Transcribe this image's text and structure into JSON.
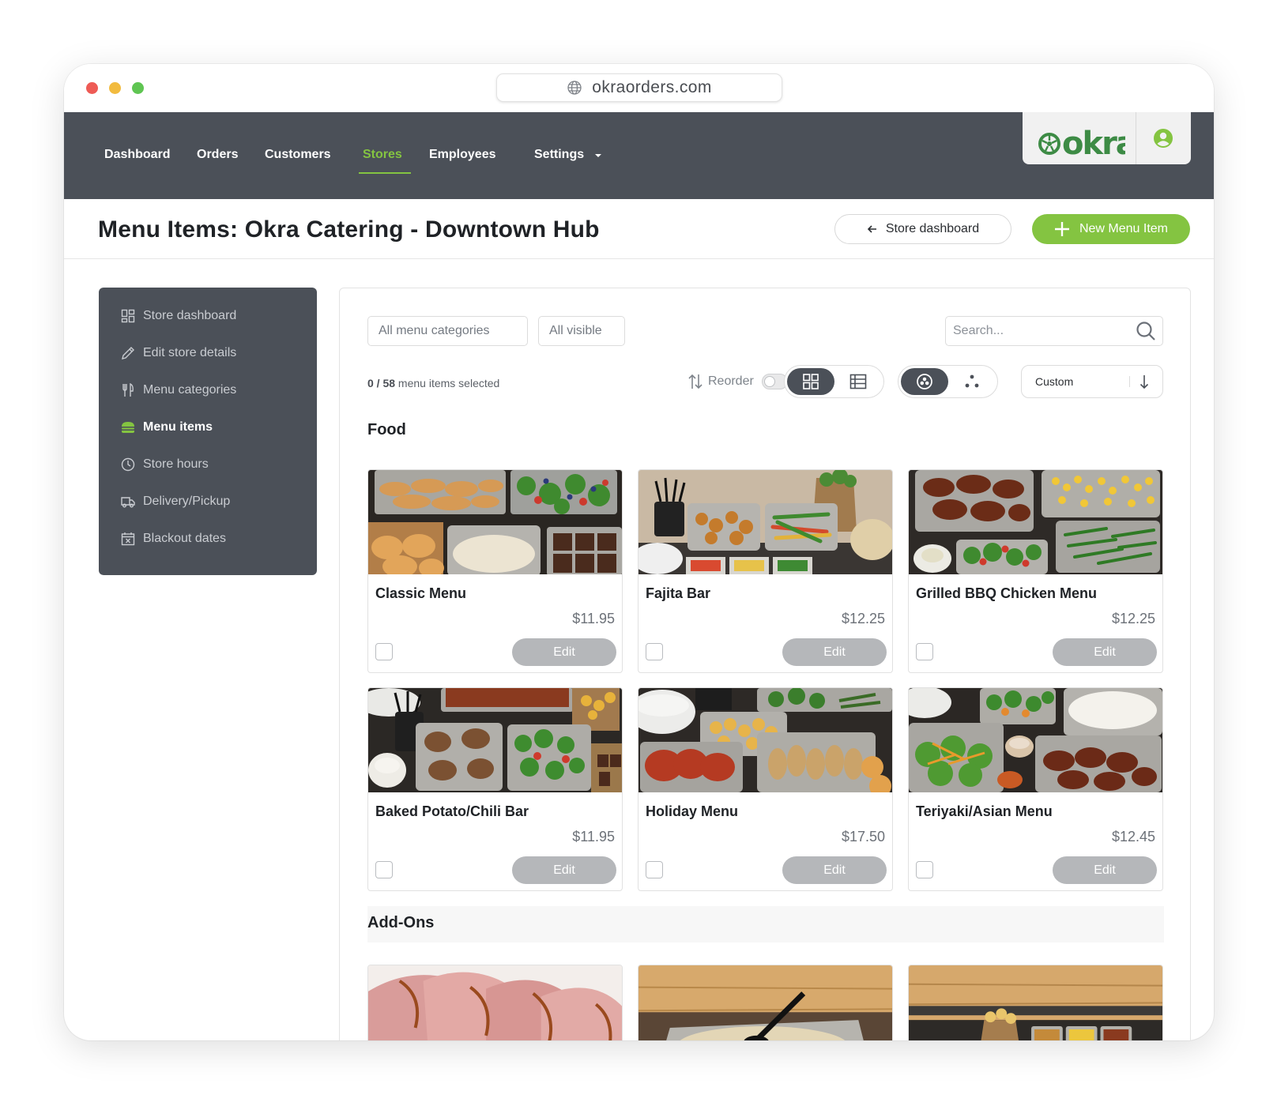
{
  "browser": {
    "url": "okraorders.com"
  },
  "nav": {
    "links": [
      "Dashboard",
      "Orders",
      "Customers",
      "Stores",
      "Employees",
      "Settings"
    ],
    "active": "Stores",
    "brand": "okra"
  },
  "header": {
    "title": "Menu Items: Okra Catering - Downtown Hub",
    "back_button": "Store dashboard",
    "new_button": "New Menu Item"
  },
  "sidebar": {
    "items": [
      {
        "label": "Store dashboard",
        "icon": "dashboard-icon"
      },
      {
        "label": "Edit store details",
        "icon": "pencil-icon"
      },
      {
        "label": "Menu categories",
        "icon": "utensils-icon"
      },
      {
        "label": "Menu items",
        "icon": "burger-icon",
        "active": true
      },
      {
        "label": "Store hours",
        "icon": "clock-icon"
      },
      {
        "label": "Delivery/Pickup",
        "icon": "truck-icon"
      },
      {
        "label": "Blackout dates",
        "icon": "calendar-x-icon"
      }
    ]
  },
  "toolbar": {
    "category_filter": "All menu categories",
    "visibility_filter": "All visible",
    "search_placeholder": "Search...",
    "selected_count": "0 / 58",
    "selected_suffix": "menu items selected",
    "reorder_label": "Reorder",
    "reorder_enabled": false,
    "sort_value": "Custom",
    "view_mode": "grid"
  },
  "sections": [
    {
      "title": "Food",
      "items": [
        {
          "name": "Classic Menu",
          "price": "$11.95",
          "edit": "Edit"
        },
        {
          "name": "Fajita Bar",
          "price": "$12.25",
          "edit": "Edit"
        },
        {
          "name": "Grilled BBQ Chicken Menu",
          "price": "$12.25",
          "edit": "Edit"
        },
        {
          "name": "Baked Potato/Chili Bar",
          "price": "$11.95",
          "edit": "Edit"
        },
        {
          "name": "Holiday Menu",
          "price": "$17.50",
          "edit": "Edit"
        },
        {
          "name": "Teriyaki/Asian Menu",
          "price": "$12.45",
          "edit": "Edit"
        }
      ]
    },
    {
      "title": "Add-Ons",
      "items": []
    }
  ],
  "colors": {
    "accent": "#84c441",
    "nav_bg": "#4b5058",
    "edit_button": "#b5b7ba"
  }
}
